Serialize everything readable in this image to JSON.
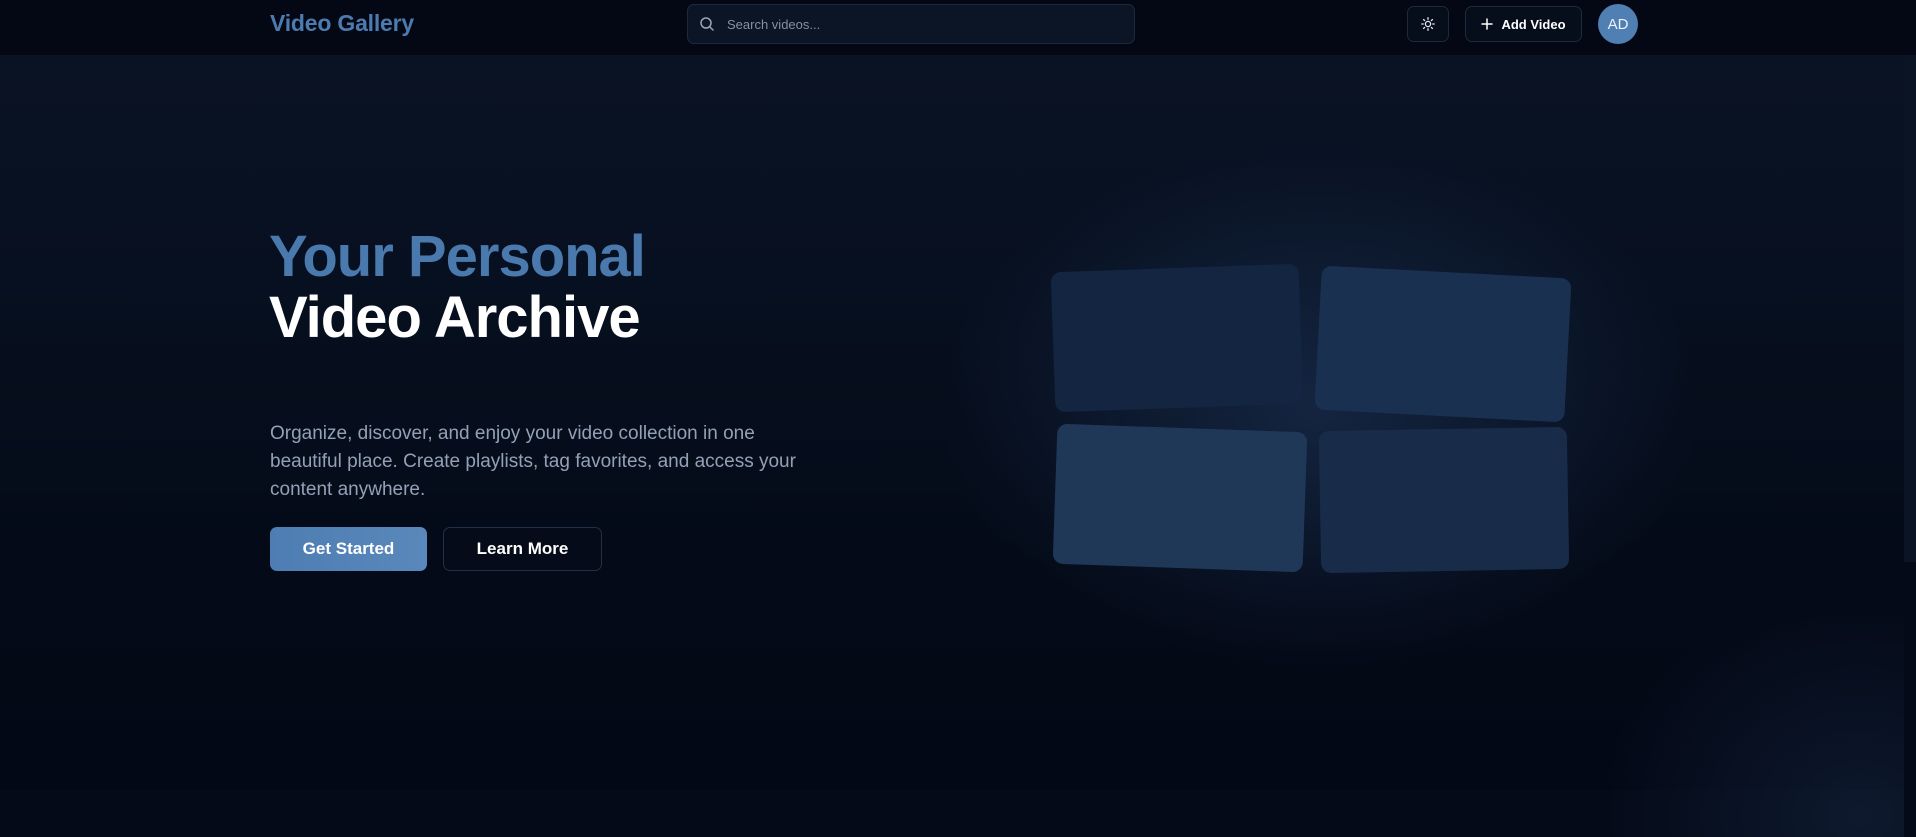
{
  "header": {
    "brand": "Video Gallery",
    "search": {
      "placeholder": "Search videos...",
      "icon": "search-icon"
    },
    "theme_toggle_icon": "sun-icon",
    "add_video": {
      "label": "Add Video",
      "icon": "plus-icon"
    },
    "avatar_initials": "AD"
  },
  "hero": {
    "title_line1": "Your Personal",
    "title_line2": "Video Archive",
    "subtitle": "Organize, discover, and enjoy your video collection in one beautiful place. Create playlists, tag favorites, and access your content anywhere.",
    "primary_button": "Get Started",
    "secondary_button": "Learn More"
  },
  "colors": {
    "accent": "#4c7bb0",
    "background": "#040a18",
    "header_background": "#030814",
    "avatar": "#4f7fb3"
  }
}
